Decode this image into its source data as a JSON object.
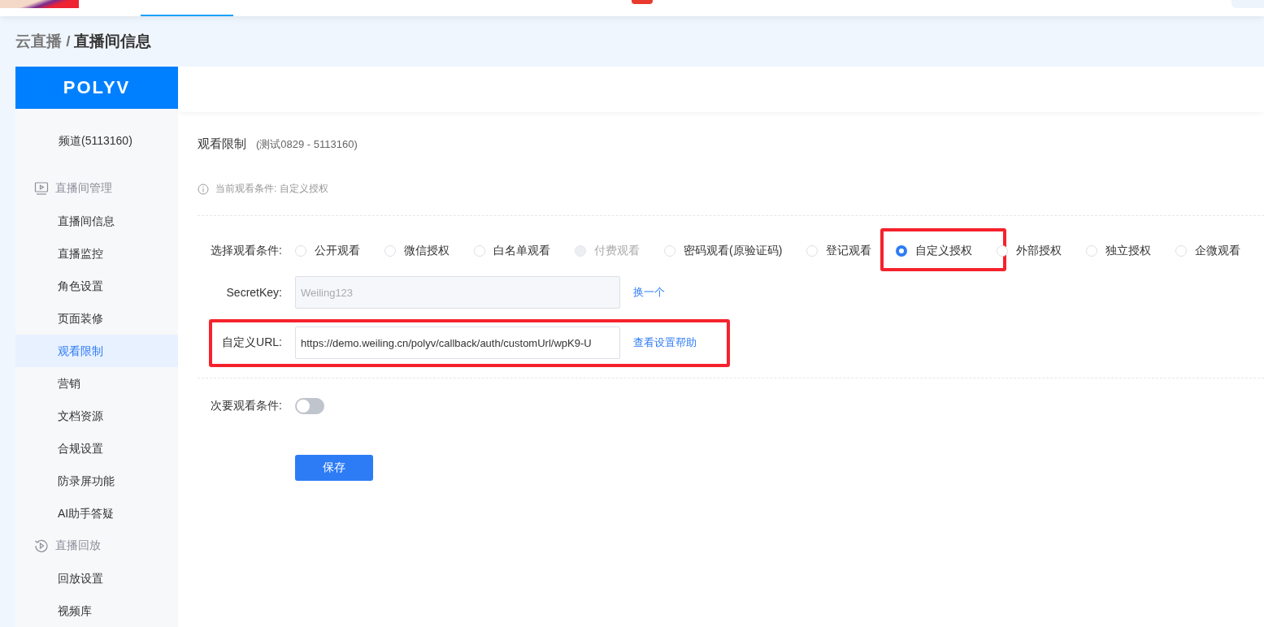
{
  "breadcrumb": {
    "parent": "云直播 /",
    "current": "直播间信息"
  },
  "logo": "POLYV",
  "sidebar": {
    "channel": "频道(5113160)",
    "groups": [
      {
        "label": "直播间管理",
        "items": [
          {
            "label": "直播间信息",
            "selected": false
          },
          {
            "label": "直播监控",
            "selected": false
          },
          {
            "label": "角色设置",
            "selected": false
          },
          {
            "label": "页面装修",
            "selected": false
          },
          {
            "label": "观看限制",
            "selected": true
          },
          {
            "label": "营销",
            "selected": false
          },
          {
            "label": "文档资源",
            "selected": false
          },
          {
            "label": "合规设置",
            "selected": false
          },
          {
            "label": "防录屏功能",
            "selected": false
          },
          {
            "label": "AI助手答疑",
            "selected": false
          }
        ]
      },
      {
        "label": "直播回放",
        "items": [
          {
            "label": "回放设置",
            "selected": false
          },
          {
            "label": "视频库",
            "selected": false
          }
        ]
      }
    ]
  },
  "content": {
    "title": "观看限制",
    "subtitle": "(测试0829 - 5113160)",
    "notice": "当前观看条件: 自定义授权",
    "condition": {
      "label": "选择观看条件:",
      "options": [
        {
          "label": "公开观看",
          "selected": false,
          "disabled": false,
          "highlighted": false
        },
        {
          "label": "微信授权",
          "selected": false,
          "disabled": false,
          "highlighted": false
        },
        {
          "label": "白名单观看",
          "selected": false,
          "disabled": false,
          "highlighted": false
        },
        {
          "label": "付费观看",
          "selected": false,
          "disabled": true,
          "highlighted": false
        },
        {
          "label": "密码观看(原验证码)",
          "selected": false,
          "disabled": false,
          "highlighted": false
        },
        {
          "label": "登记观看",
          "selected": false,
          "disabled": false,
          "highlighted": false
        },
        {
          "label": "自定义授权",
          "selected": true,
          "disabled": false,
          "highlighted": true
        },
        {
          "label": "外部授权",
          "selected": false,
          "disabled": false,
          "highlighted": false
        },
        {
          "label": "独立授权",
          "selected": false,
          "disabled": false,
          "highlighted": false
        },
        {
          "label": "企微观看",
          "selected": false,
          "disabled": false,
          "highlighted": false
        }
      ]
    },
    "secret_key": {
      "label": "SecretKey:",
      "value": "Weiling123",
      "disabled": true,
      "link": "换一个"
    },
    "custom_url": {
      "label": "自定义URL:",
      "value": "https://demo.weiling.cn/polyv/callback/auth/customUrl/wpK9-U",
      "disabled": false,
      "link": "查看设置帮助",
      "highlighted": true
    },
    "secondary": {
      "label": "次要观看条件:",
      "on": false
    },
    "save_button": "保存"
  }
}
